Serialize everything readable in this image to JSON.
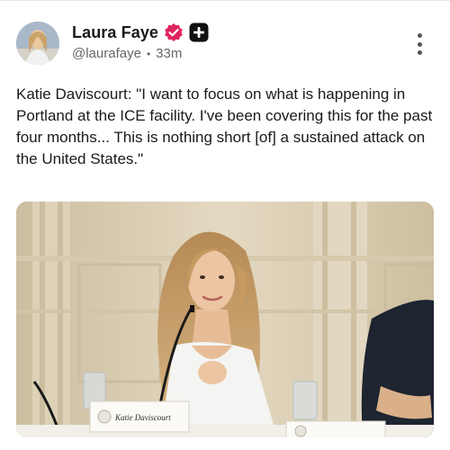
{
  "post": {
    "display_name": "Laura Faye",
    "handle": "@laurafaye",
    "time": "33m",
    "separator": "•",
    "text": "Katie Daviscourt: \"I want to focus on what is happening in Portland at the ICE facility. I've been covering this for the past four months... This is nothing short [of] a sustained attack on the United States.\""
  },
  "media": {
    "nameplate_label": "Katie Daviscourt"
  },
  "icons": {
    "verified": "verified-badge-icon",
    "plus": "plus-badge-icon",
    "more": "more-vertical-icon"
  },
  "colors": {
    "verified_badge": "#e0245e",
    "text_primary": "#1a1a1a",
    "text_secondary": "#666666"
  }
}
